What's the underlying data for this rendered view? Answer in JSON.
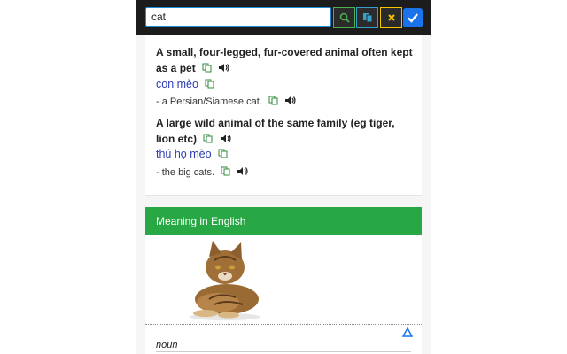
{
  "search": {
    "value": "cat"
  },
  "toolbar": {
    "search_icon": "search-icon",
    "copy_icon": "copy-icon",
    "close_icon": "close-icon",
    "check_icon": "check-icon"
  },
  "definitions": [
    {
      "definition": "A small, four-legged, fur-covered animal often kept as a pet",
      "translation": "con mèo",
      "example": "- a Persian/Siamese cat."
    },
    {
      "definition": "A large wild animal of the same family (eg tiger, lion etc)",
      "translation": "thú họ mèo",
      "example": "- the big cats."
    }
  ],
  "meaning": {
    "header": "Meaning in English",
    "part_of_speech": "noun"
  },
  "colors": {
    "header_green": "#28a745",
    "translation_blue": "#2d3bb5",
    "accent_blue": "#1a73e8"
  }
}
